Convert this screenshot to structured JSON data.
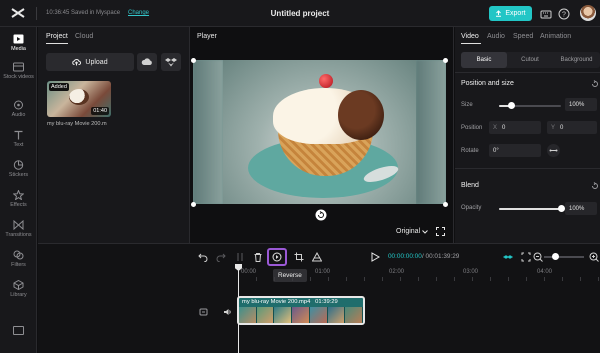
{
  "topbar": {
    "saved_text": "10:36:45 Saved in Myspace",
    "change_link": "Change",
    "project_title": "Untitled project",
    "export_label": "Export"
  },
  "nav": {
    "items": [
      {
        "label": "Media",
        "icon": "media-icon"
      },
      {
        "label": "Stock videos",
        "icon": "stock-videos-icon"
      },
      {
        "label": "Audio",
        "icon": "audio-icon"
      },
      {
        "label": "Text",
        "icon": "text-icon"
      },
      {
        "label": "Stickers",
        "icon": "stickers-icon"
      },
      {
        "label": "Effects",
        "icon": "effects-icon"
      },
      {
        "label": "Transitions",
        "icon": "transitions-icon"
      },
      {
        "label": "Filters",
        "icon": "filters-icon"
      },
      {
        "label": "Library",
        "icon": "library-icon"
      }
    ]
  },
  "media": {
    "tabs": [
      "Project",
      "Cloud"
    ],
    "upload_label": "Upload",
    "item": {
      "badge": "Added",
      "duration": "01:40",
      "name": "my blu-ray Movie 200.m"
    }
  },
  "player": {
    "title": "Player",
    "ratio_label": "Original"
  },
  "props": {
    "tabs": [
      "Video",
      "Audio",
      "Speed",
      "Animation"
    ],
    "subtabs": [
      "Basic",
      "Cutout",
      "Background"
    ],
    "position_size": {
      "title": "Position and size",
      "size_label": "Size",
      "size_value": "100%",
      "size_fraction": 0.2,
      "position_label": "Position",
      "x_axis": "X",
      "x_value": "0",
      "y_axis": "Y",
      "y_value": "0",
      "rotate_label": "Rotate",
      "rotate_value": "0°"
    },
    "blend": {
      "title": "Blend",
      "opacity_label": "Opacity",
      "opacity_value": "100%",
      "opacity_fraction": 1.0
    }
  },
  "timeline": {
    "tooltip": "Reverse",
    "time_current": "00:00:00:00",
    "time_total": "/ 00:01:39:29",
    "ticks": [
      "00:00",
      "01:00",
      "02:00",
      "03:00",
      "04:00"
    ],
    "clip": {
      "name": "my blu-ray Movie 200.mp4",
      "duration": "01:39:29"
    }
  },
  "colors": {
    "accent": "#22c6c6",
    "highlight": "#9b59d6",
    "background": "#0f0f11",
    "panel": "#18181b"
  }
}
